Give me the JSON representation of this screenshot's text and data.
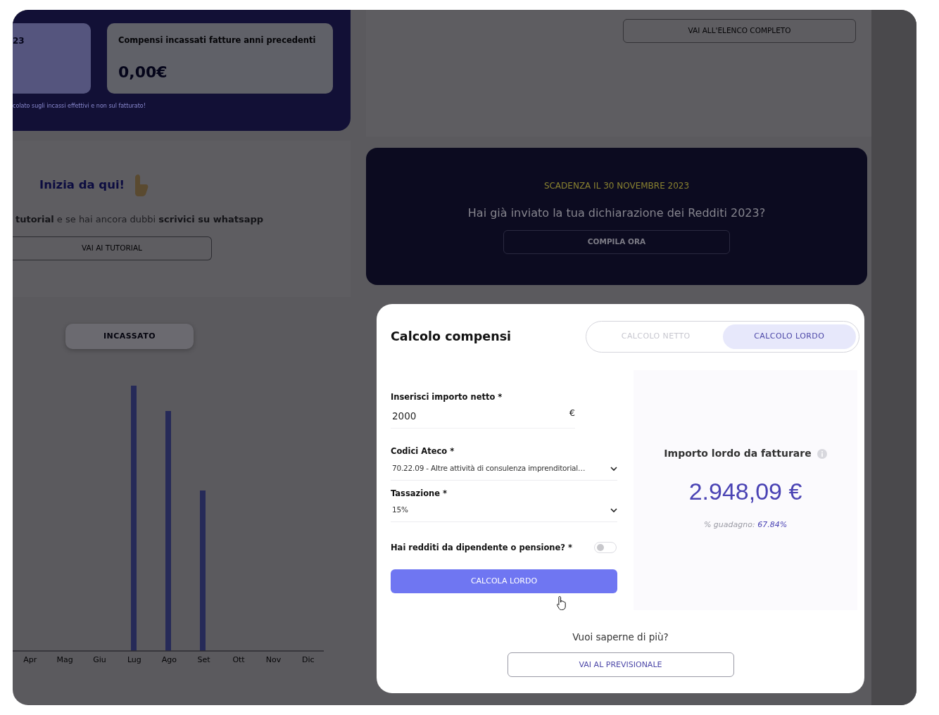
{
  "summary_panel": {
    "cards": [
      {
        "title": "23"
      },
      {
        "title": "Compensi incassati fatture anni precedenti",
        "value": "0,00€"
      }
    ],
    "note": "colato sugli incassi effettivi e non sul fatturato!"
  },
  "start_panel": {
    "title": "Inizia da qui!",
    "text": "**tutorial** e se hai ancora dubbi **scrivici su whatsapp**",
    "button": "VAI AI TUTORIAL"
  },
  "chart": {
    "tabs": [
      {
        "label": "INCASSATO",
        "selected": true
      }
    ],
    "months": [
      "Apr",
      "Mag",
      "Giu",
      "Lug",
      "Ago",
      "Set",
      "Ott",
      "Nov",
      "Dic"
    ]
  },
  "list_panel": {
    "button": "VAI ALL'ELENCO COMPLETO"
  },
  "deadline_banner": {
    "eyebrow": "SCADENZA IL 30 NOVEMBRE 2023",
    "question": "Hai già inviato la tua dichiarazione dei Redditi 2023?",
    "button": "COMPILA ORA"
  },
  "modal": {
    "title": "Calcolo compensi",
    "tabs": [
      {
        "label": "CALCOLO NETTO",
        "selected": false
      },
      {
        "label": "CALCOLO LORDO",
        "selected": true
      }
    ],
    "fields": [
      {
        "kind": "input",
        "label": "Inserisci importo netto *",
        "value": "2000",
        "suffix": "€"
      },
      {
        "kind": "select",
        "label": "Codici Ateco *",
        "value": "70.22.09 - Altre attività di consulenza imprenditorial…"
      },
      {
        "kind": "select",
        "label": "Tassazione *",
        "value": "15%"
      },
      {
        "kind": "toggle",
        "label": "Hai redditi da dipendente o pensione? *",
        "on": false
      }
    ],
    "submit": "CALCOLA LORDO",
    "result": {
      "label": "Importo lordo da fatturare",
      "value": "2.948,09 €",
      "gain_label": "% guadagno:",
      "gain_value": "67.84%"
    },
    "more_text": "Vuoi saperne di più?",
    "more_button": "VAI AL PREVISIONALE"
  }
}
